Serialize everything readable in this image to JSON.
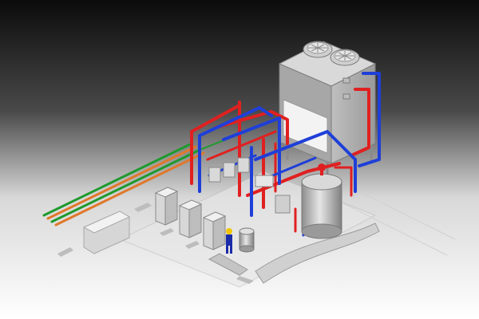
{
  "scene": {
    "subject": "isometric-3d-render-cooling-plant",
    "colors": {
      "background_top": "#0b0b0b",
      "background_bottom": "#ffffff",
      "floor": "#ececec",
      "concrete": "#cfcfcf",
      "equipment": "#bdbdbd",
      "cooling_tower": "#b9b9b9",
      "hot_pipe": "#e02020",
      "cold_pipe": "#1f3fd8",
      "green_pipe": "#1f9a2e",
      "orange_pipe": "#e0782a",
      "tank": "#c8c8c8",
      "worker": "#1b2aa8",
      "helmet": "#f3c400"
    },
    "components": {
      "cooling_tower_fans": 2,
      "control_cabinets": 3,
      "vertical_tank": 1,
      "small_tank": 1,
      "worker": 1
    }
  }
}
